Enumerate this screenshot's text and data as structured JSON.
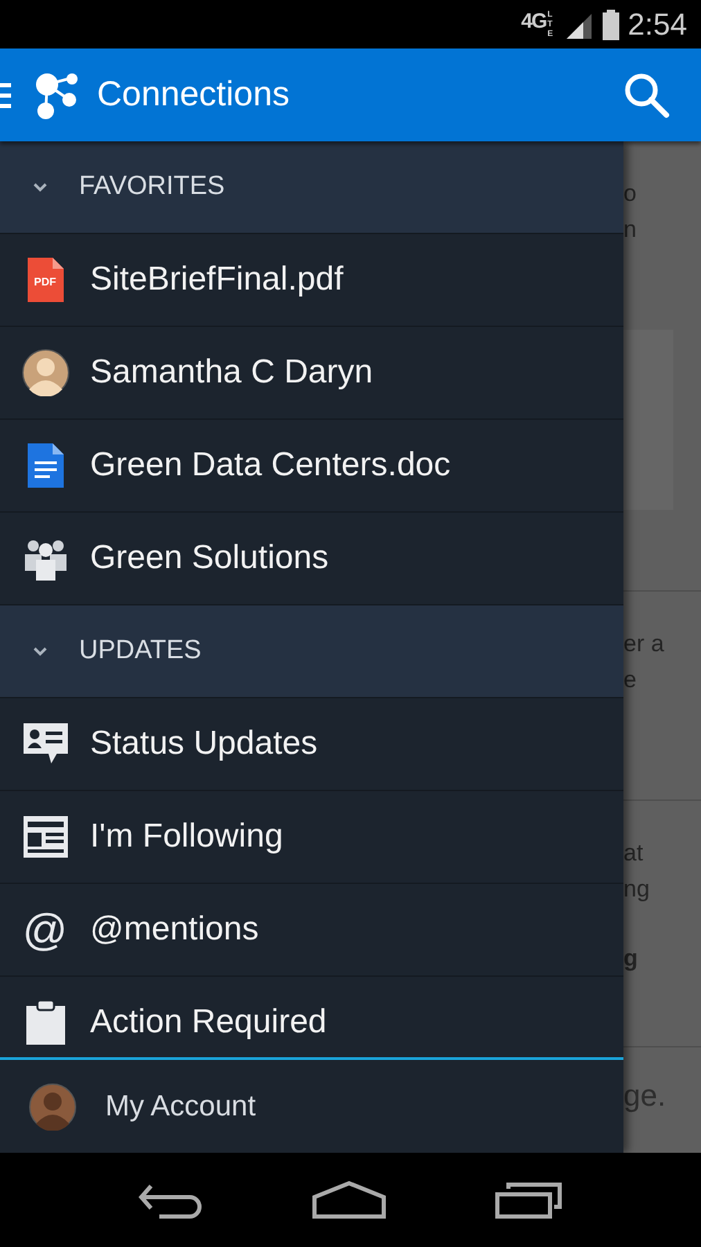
{
  "status_bar": {
    "network": "4G",
    "network_sub": "LTE",
    "time": "2:54"
  },
  "app_bar": {
    "title": "Connections"
  },
  "drawer": {
    "sections": [
      {
        "title": "FAVORITES",
        "expanded": true,
        "items": [
          {
            "label": "SiteBriefFinal.pdf",
            "icon_label": "PDF"
          },
          {
            "label": "Samantha C Daryn"
          },
          {
            "label": "Green Data Centers.doc"
          },
          {
            "label": "Green Solutions"
          }
        ]
      },
      {
        "title": "UPDATES",
        "expanded": true,
        "items": [
          {
            "label": "Status Updates"
          },
          {
            "label": "I'm Following"
          },
          {
            "label": "@mentions",
            "icon_text": "@"
          },
          {
            "label": "Action Required"
          }
        ]
      }
    ],
    "account": {
      "label": "My Account"
    }
  },
  "background": {
    "cards": [
      {
        "lines": [
          {
            "text": "o",
            "bold": false
          },
          {
            "text": "n",
            "bold": false
          }
        ]
      },
      {
        "lines": [
          {
            "text": "er a",
            "bold": false
          },
          {
            "text": "e",
            "bold": false
          }
        ]
      },
      {
        "lines": [
          {
            "text": "at",
            "bold": false
          },
          {
            "text": "ng",
            "bold": false
          },
          {
            "text": "g",
            "bold": true
          }
        ]
      },
      {
        "lines": [
          {
            "text": "ge.",
            "bold": false
          }
        ]
      }
    ]
  }
}
